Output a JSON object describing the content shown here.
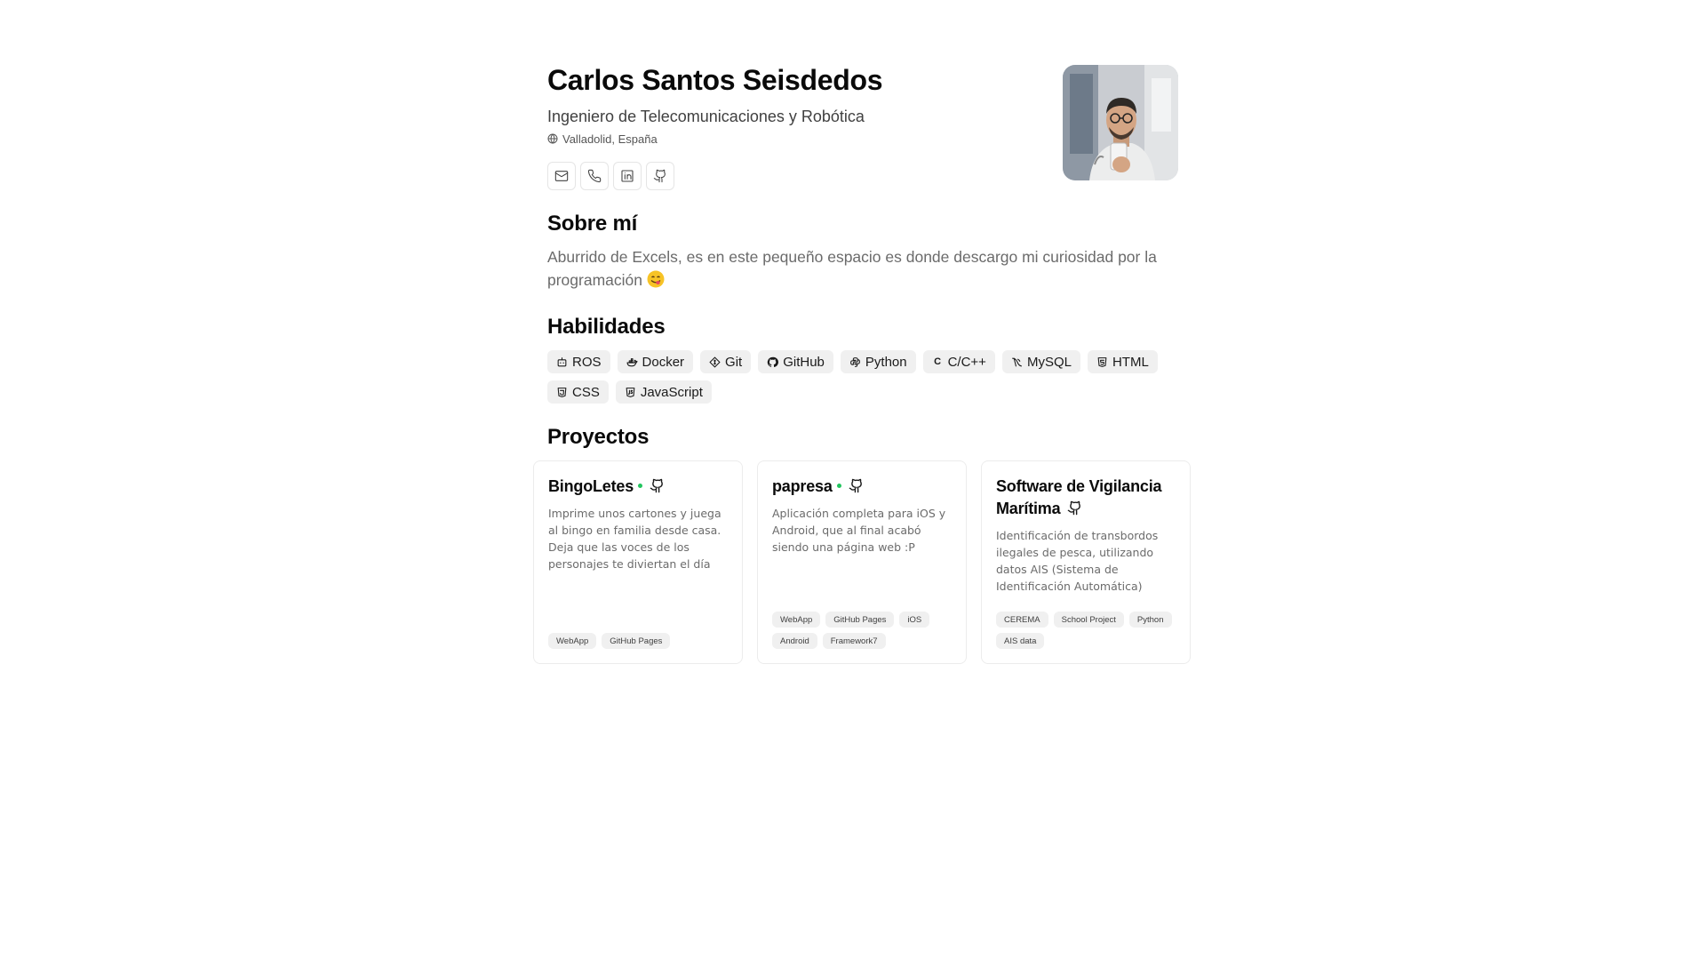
{
  "profile": {
    "name": "Carlos Santos Seisdedos",
    "title": "Ingeniero de Telecomunicaciones y Robótica",
    "location": "Valladolid, España"
  },
  "contacts": [
    {
      "icon": "mail-icon"
    },
    {
      "icon": "phone-icon"
    },
    {
      "icon": "linkedin-icon"
    },
    {
      "icon": "github-icon"
    }
  ],
  "about": {
    "heading": "Sobre mí",
    "text": "Aburrido de Excels, es en este pequeño espacio es donde descargo mi curiosidad por la programación"
  },
  "skills": {
    "heading": "Habilidades",
    "items": [
      {
        "label": "ROS",
        "icon": "robot-icon"
      },
      {
        "label": "Docker",
        "icon": "docker-icon"
      },
      {
        "label": "Git",
        "icon": "git-icon"
      },
      {
        "label": "GitHub",
        "icon": "github-icon"
      },
      {
        "label": "Python",
        "icon": "python-icon"
      },
      {
        "label": "C/C++",
        "icon": "c-icon"
      },
      {
        "label": "MySQL",
        "icon": "mysql-icon"
      },
      {
        "label": "HTML",
        "icon": "html-icon"
      },
      {
        "label": "CSS",
        "icon": "css-icon"
      },
      {
        "label": "JavaScript",
        "icon": "javascript-icon"
      }
    ]
  },
  "projects": {
    "heading": "Proyectos",
    "items": [
      {
        "title": "BingoLetes",
        "active": true,
        "description": "Imprime unos cartones y juega al bingo en familia desde casa. Deja que las voces de los personajes te diviertan el día",
        "tags": [
          "WebApp",
          "GitHub Pages"
        ]
      },
      {
        "title": "papresa",
        "active": true,
        "description": "Aplicación completa para iOS y Android, que al final acabó siendo una página web :P",
        "tags": [
          "WebApp",
          "GitHub Pages",
          "iOS",
          "Android",
          "Framework7"
        ]
      },
      {
        "title": "Software de Vigilancia Marítima",
        "active": false,
        "description": "Identificación de transbordos ilegales de pesca, utilizando datos AIS (Sistema de Identificación Automática)",
        "tags": [
          "CEREMA",
          "School Project",
          "Python",
          "AIS data"
        ]
      }
    ]
  },
  "colors": {
    "active_dot": "#22c55e",
    "tag_bg": "#f0f0f0",
    "muted_text": "#6b6b6b"
  }
}
